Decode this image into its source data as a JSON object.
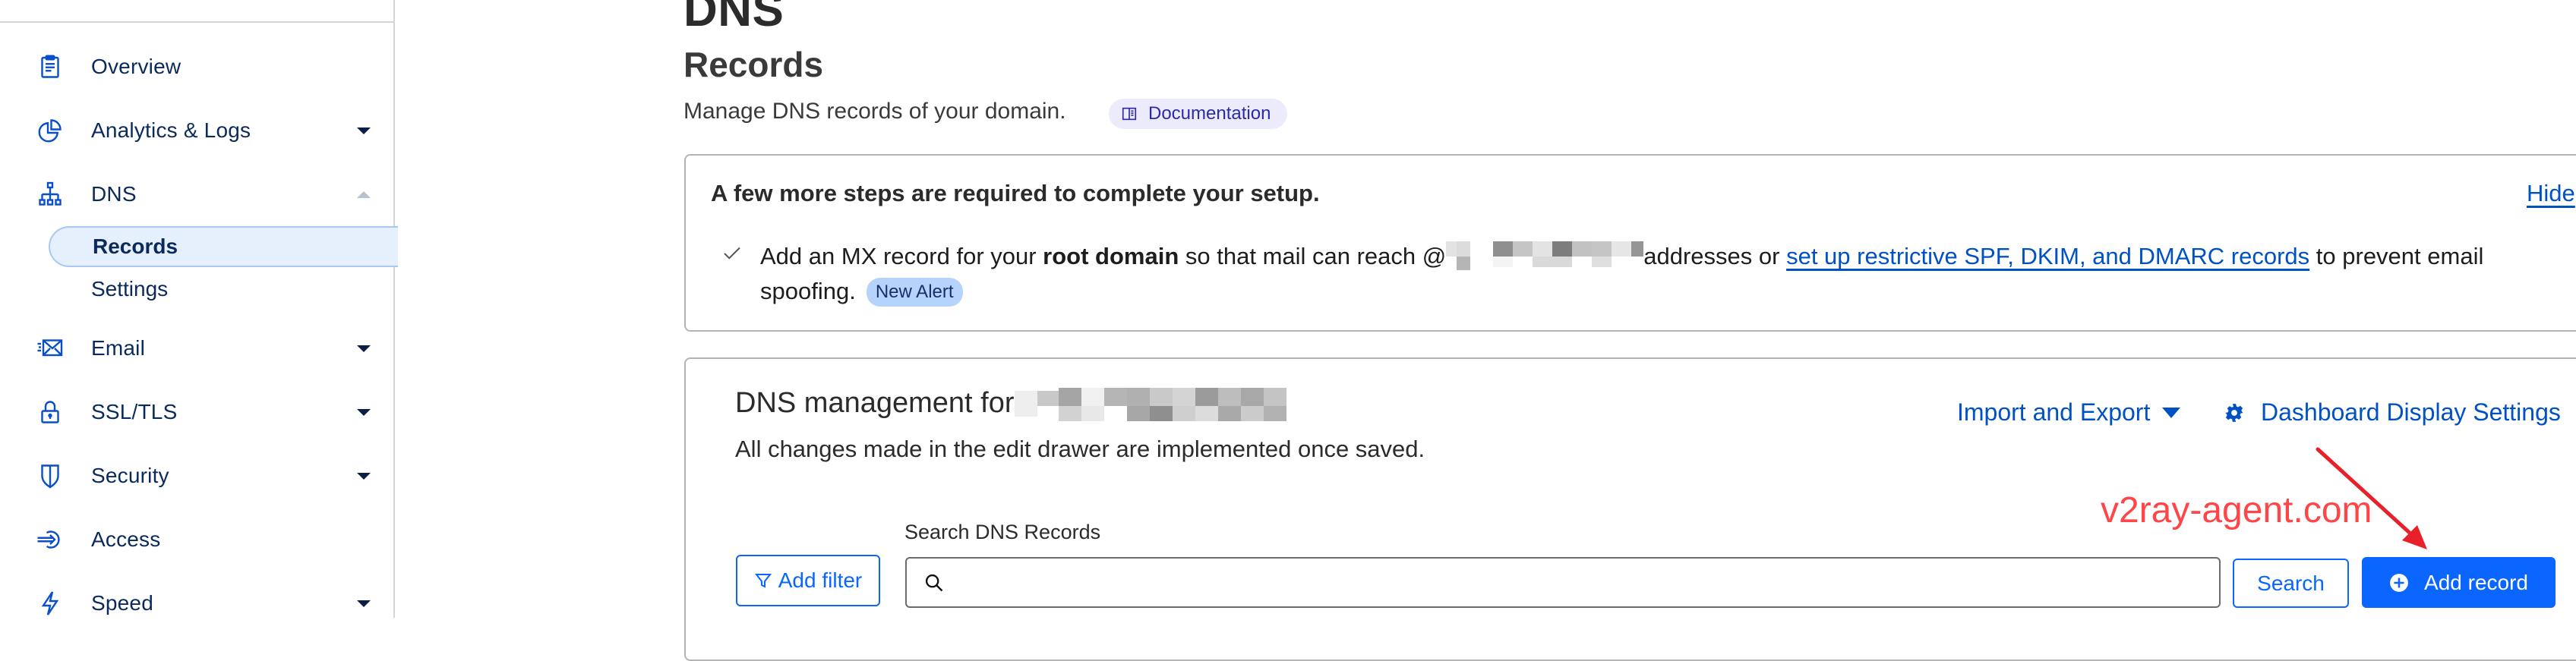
{
  "sidebar": {
    "items": [
      {
        "label": "Overview",
        "icon": "clipboard-icon",
        "caret": "none"
      },
      {
        "label": "Analytics & Logs",
        "icon": "pie-chart-icon",
        "caret": "down"
      },
      {
        "label": "DNS",
        "icon": "network-icon",
        "caret": "up",
        "expanded": true,
        "children": [
          {
            "label": "Records",
            "active": true
          },
          {
            "label": "Settings",
            "active": false
          }
        ]
      },
      {
        "label": "Email",
        "icon": "email-icon",
        "caret": "down"
      },
      {
        "label": "SSL/TLS",
        "icon": "lock-icon",
        "caret": "down"
      },
      {
        "label": "Security",
        "icon": "shield-icon",
        "caret": "down"
      },
      {
        "label": "Access",
        "icon": "access-icon",
        "caret": "none"
      },
      {
        "label": "Speed",
        "icon": "lightning-icon",
        "caret": "down"
      }
    ]
  },
  "header": {
    "title": "DNS",
    "subtitle": "Records",
    "description": "Manage DNS records of your domain.",
    "doc_badge": "Documentation"
  },
  "alert": {
    "title": "A few more steps are required to complete your setup.",
    "hide_label": "Hide",
    "item": {
      "text_before": "Add an MX record for your ",
      "bold": "root domain",
      "text_mid": " so that mail can reach @",
      "text_after": "addresses or ",
      "link": "set up restrictive SPF, DKIM, and DMARC records",
      "text_end": " to prevent email spoofing.",
      "badge": "New Alert"
    }
  },
  "dns_card": {
    "title_prefix": "DNS management for",
    "description": "All changes made in the edit drawer are implemented once saved.",
    "import_export_label": "Import and Export",
    "display_settings_label": "Dashboard Display Settings",
    "search_label": "Search DNS Records",
    "search_value": "",
    "add_filter_label": "Add filter",
    "search_button_label": "Search",
    "add_record_label": "Add record"
  },
  "annotation": {
    "watermark": "v2ray-agent.com",
    "color": "#ff4548"
  },
  "colors": {
    "accent": "#0a66ff",
    "link": "#0051c3",
    "nav_text": "#0b2a5c",
    "active_bg": "#e6f0fd"
  }
}
